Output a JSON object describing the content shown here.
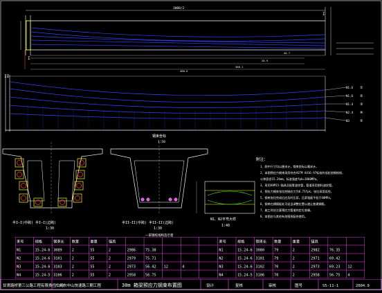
{
  "drawing": {
    "title_main": "30m 箱梁预应力钢束布置图",
    "org": "甘肃路桥第三公路工程有限责任公司",
    "project": "广州市中山快速路三期工程",
    "design_label": "设计",
    "review_label": "复核",
    "check_label": "审核",
    "drawing_no_label": "图号",
    "drawing_no": "S5-11-1",
    "date": "2004.9"
  },
  "elevation": {
    "dim_top": "3000/2",
    "label_i_left": "I",
    "label_i_right": "I",
    "label_ii_left": "II",
    "tendons": [
      "N1.6",
      "N1.6",
      "N1.4",
      "N2.4",
      "N3"
    ],
    "right_marks": [
      "①",
      "②",
      "③",
      "④",
      "⑤"
    ],
    "dims": [
      "400.6",
      "300.1",
      "44.7",
      "20.9"
    ],
    "plan_title": "钢束坐标",
    "scale_elev": "1:50"
  },
  "sections": {
    "left_caption": "半I—I(中跨) 半I—I(边跨)",
    "left_scale": "1:30",
    "mid_caption": "半II—II(中跨) 半II—II(边跨)",
    "mid_scale": "1:30",
    "mid_sub": "一束钢绞线构造示意",
    "right_caption": "N1、N2平弯大样",
    "right_scale": "1:40"
  },
  "notes": {
    "heading": "附注：",
    "lines": [
      "1、图中尺寸均以厘米计，钢束坐标以毫米计。",
      "2、本图预应力钢束采用符合ASTM A416-97标准的低松弛钢绞线，",
      "   公称直径15.24mm，标准强度fpk=1860MPa。",
      "3、采用OVM15-锚具及配套波纹管，管道采用塑料波纹管。",
      "4、预应力钢束张拉控制应力为0.75fpk，张拉采用双控。",
      "5、钢束张拉完成后应及时压浆，压浆强度不低于40MPa。",
      "6、钢束在横隔板处可适当调整位置以避让普通钢筋。",
      "7、施工时应注意预应力管道的定位准确。",
      "8、本图应与其他有关图纸配合使用。"
    ]
  },
  "table": {
    "header_top": [
      "束号",
      "规格",
      "钢束长",
      "数量",
      "重量",
      "锚具",
      "",
      "",
      "",
      "",
      "",
      "束号",
      "规格",
      "钢束长",
      "数量",
      "重量",
      "锚具",
      "",
      ""
    ],
    "rows": [
      [
        "N1",
        "15.24-6",
        "3089",
        "2",
        "55",
        "2",
        "2986",
        "75.38",
        "",
        "",
        "",
        "N1",
        "15.24-6",
        "3080",
        "79",
        "2",
        "2982",
        "76.35",
        ""
      ],
      [
        "N2",
        "15.24-6",
        "3101",
        "2",
        "55",
        "2",
        "2979",
        "75.71",
        "",
        "",
        "",
        "N2",
        "15.24-6",
        "3101",
        "79",
        "2",
        "2971",
        "69.42",
        ""
      ],
      [
        "N3",
        "15.24-6",
        "3103",
        "2",
        "55",
        "2",
        "2973",
        "56.42",
        "12",
        "4",
        "",
        "N3",
        "15.24-6",
        "3102",
        "70",
        "2",
        "2973",
        "69.23",
        "12"
      ],
      [
        "N4",
        "15.24-5",
        "3106",
        "2",
        "55",
        "2",
        "2958",
        "56.75",
        "",
        "",
        "",
        "N4",
        "15.24-5",
        "3106",
        "70",
        "2",
        "2958",
        "56.75",
        "4"
      ]
    ]
  },
  "colors": {
    "bg": "#000000",
    "line": "#ffffff",
    "tendon": "#3344ff",
    "accent": "#ffff00",
    "magenta": "#ff44ff",
    "red": "#ff3333",
    "green": "#33ff33",
    "cyan": "#00ffff"
  }
}
